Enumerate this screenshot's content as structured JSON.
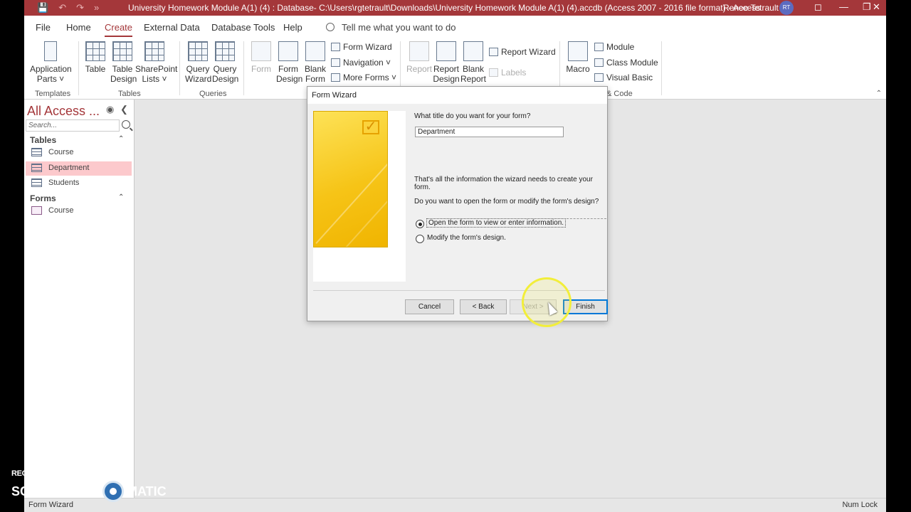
{
  "window": {
    "title": "University Homework Module A(1) (4) : Database- C:\\Users\\rgtetrault\\Downloads\\University Homework Module A(1) (4).accdb (Access 2007 - 2016 file format)  -  Access",
    "user": "Renee Tetrault",
    "user_initials": "RT",
    "accent": "#a4373a"
  },
  "tabs": [
    "File",
    "Home",
    "Create",
    "External Data",
    "Database Tools",
    "Help"
  ],
  "active_tab": "Create",
  "tell_me": "Tell me what you want to do",
  "ribbon": {
    "application_parts": "Application",
    "application_parts2": "Parts ˅",
    "table": "Table",
    "table_design1": "Table",
    "table_design2": "Design",
    "sharepoint1": "SharePoint",
    "sharepoint2": "Lists ˅",
    "query_wizard1": "Query",
    "query_wizard2": "Wizard",
    "query_design1": "Query",
    "query_design2": "Design",
    "form": "Form",
    "form_design1": "Form",
    "form_design2": "Design",
    "blank_form1": "Blank",
    "blank_form2": "Form",
    "form_wizard": "Form Wizard",
    "navigation": "Navigation ˅",
    "more_forms": "More Forms ˅",
    "report": "Report",
    "report_design1": "Report",
    "report_design2": "Design",
    "blank_report1": "Blank",
    "blank_report2": "Report",
    "report_wizard": "Report Wizard",
    "labels": "Labels",
    "macro": "Macro",
    "module": "Module",
    "class_module": "Class Module",
    "visual_basic": "Visual Basic",
    "groups": {
      "templates": "Templates",
      "tables": "Tables",
      "queries": "Queries",
      "macros_code": "& Code"
    }
  },
  "nav": {
    "header": "All Access ...",
    "search_placeholder": "Search...",
    "sections": [
      {
        "label": "Tables",
        "items": [
          "Course",
          "Department",
          "Students"
        ]
      },
      {
        "label": "Forms",
        "items": [
          "Course"
        ]
      }
    ],
    "selected": "Department",
    "selected_color": "#fcc9cc"
  },
  "dialog": {
    "title": "Form Wizard",
    "q_title": "What title do you want for your form?",
    "title_value": "Department",
    "info": "That's all the information the wizard needs to create your form.",
    "q_open": "Do you want to open the form or modify the form's design?",
    "options": [
      "Open the form to view or enter information.",
      "Modify the form's design."
    ],
    "selected_option": 0,
    "buttons": {
      "cancel": "Cancel",
      "back": "< Back",
      "next": "Next >",
      "finish": "Finish"
    }
  },
  "status": {
    "left": "Form Wizard",
    "right": "Num Lock"
  },
  "watermark": {
    "line1": "RECORDED WITH",
    "line2a": "SCREENCAST",
    "line2b": "MATIC"
  }
}
